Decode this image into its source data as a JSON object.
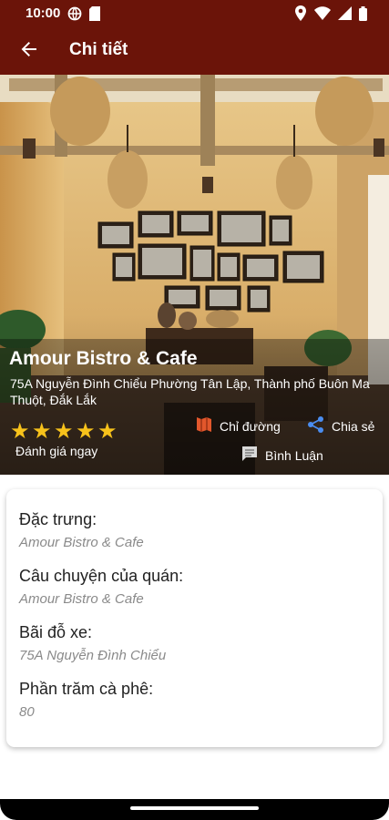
{
  "status_bar": {
    "time": "10:00",
    "left_icons": [
      "vpn-globe-icon",
      "sd-card-icon"
    ],
    "right_icons": [
      "location-icon",
      "wifi-icon",
      "signal-icon",
      "battery-icon"
    ]
  },
  "app_bar": {
    "title": "Chi tiết",
    "back_icon": "arrow-back-icon",
    "color": "#6b1409"
  },
  "place": {
    "name": "Amour Bistro & Cafe",
    "address": "75A Nguyễn Đình Chiểu Phường Tân Lập, Thành phố Buôn Ma Thuột, Đắk Lắk",
    "rating_stars": 5,
    "rating_max": 5,
    "rate_label": "Đánh giá ngay",
    "star_color": "#f7c21b"
  },
  "actions": {
    "direction_label": "Chỉ đường",
    "share_label": "Chia sẻ",
    "comment_label": "Bình Luận",
    "direction_color": "#e2572c",
    "share_color": "#4a8df0"
  },
  "details": [
    {
      "label": "Đặc trưng:",
      "value": "Amour Bistro & Cafe"
    },
    {
      "label": "Câu chuyện của quán:",
      "value": "Amour Bistro & Cafe"
    },
    {
      "label": "Bãi đỗ xe:",
      "value": "75A Nguyễn Đình Chiểu"
    },
    {
      "label": "Phần trăm cà phê:",
      "value": "80"
    }
  ]
}
